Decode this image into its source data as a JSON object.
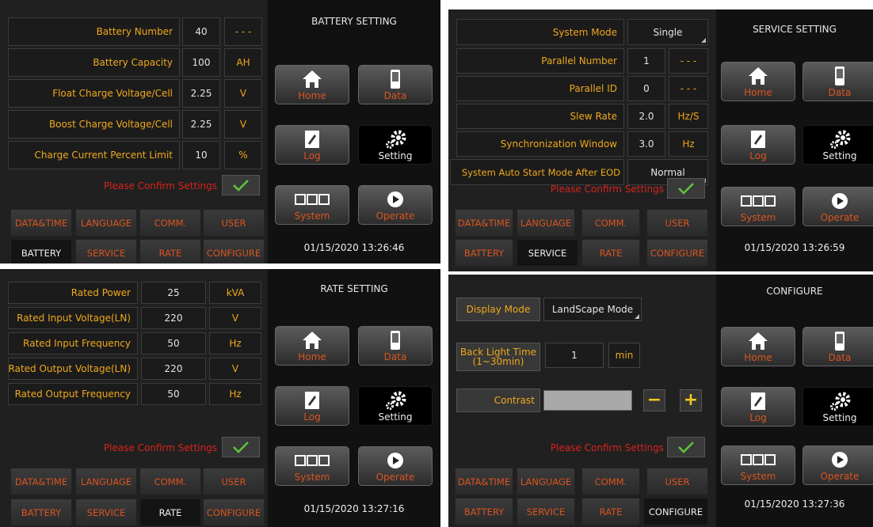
{
  "nav": {
    "home": "Home",
    "data": "Data",
    "log": "Log",
    "setting": "Setting",
    "system": "System",
    "operate": "Operate"
  },
  "tabs": [
    "DATA&TIME",
    "LANGUAGE",
    "COMM.",
    "USER",
    "BATTERY",
    "SERVICE",
    "RATE",
    "CONFIGURE"
  ],
  "confirm": "Please Confirm Settings",
  "colors": {
    "label": "#f0a81c",
    "tab": "#d9541f",
    "confirm": "#d8231d",
    "check": "#5ec23a"
  },
  "battery": {
    "title": "BATTERY SETTING",
    "rows": [
      {
        "label": "Battery Number",
        "value": "40",
        "unit": "- - -"
      },
      {
        "label": "Battery Capacity",
        "value": "100",
        "unit": "AH"
      },
      {
        "label": "Float Charge Voltage/Cell",
        "value": "2.25",
        "unit": "V"
      },
      {
        "label": "Boost Charge Voltage/Cell",
        "value": "2.25",
        "unit": "V"
      },
      {
        "label": "Charge Current Percent Limit",
        "value": "10",
        "unit": "%"
      }
    ],
    "active_tab": "BATTERY",
    "datetime": "01/15/2020  13:26:46"
  },
  "service": {
    "title": "SERVICE SETTING",
    "system_mode": {
      "label": "System Mode",
      "value": "Single"
    },
    "rows": [
      {
        "label": "Parallel Number",
        "value": "1",
        "unit": "- - -"
      },
      {
        "label": "Parallel ID",
        "value": "0",
        "unit": "- - -"
      },
      {
        "label": "Slew Rate",
        "value": "2.0",
        "unit": "Hz/S"
      },
      {
        "label": "Synchronization Window",
        "value": "3.0",
        "unit": "Hz"
      }
    ],
    "auto_start": {
      "label": "System Auto Start Mode After EOD",
      "value": "Normal"
    },
    "active_tab": "SERVICE",
    "datetime": "01/15/2020  13:26:59"
  },
  "rate": {
    "title": "RATE SETTING",
    "rows": [
      {
        "label": "Rated Power",
        "value": "25",
        "unit": "kVA"
      },
      {
        "label": "Rated Input Voltage(LN)",
        "value": "220",
        "unit": "V"
      },
      {
        "label": "Rated Input Frequency",
        "value": "50",
        "unit": "Hz"
      },
      {
        "label": "Rated Output Voltage(LN)",
        "value": "220",
        "unit": "V"
      },
      {
        "label": "Rated Output Frequency",
        "value": "50",
        "unit": "Hz"
      }
    ],
    "active_tab": "RATE",
    "datetime": "01/15/2020  13:27:16"
  },
  "configure": {
    "title": "CONFIGURE",
    "display_mode": {
      "label": "Display Mode",
      "value": "LandScape Mode"
    },
    "backlight": {
      "label_line1": "Back Light Time",
      "label_line2": "(1~30min)",
      "value": "1",
      "unit": "min"
    },
    "contrast": {
      "label": "Contrast",
      "minus": "−",
      "plus": "+"
    },
    "active_tab": "CONFIGURE",
    "datetime": "01/15/2020  13:27:36"
  }
}
